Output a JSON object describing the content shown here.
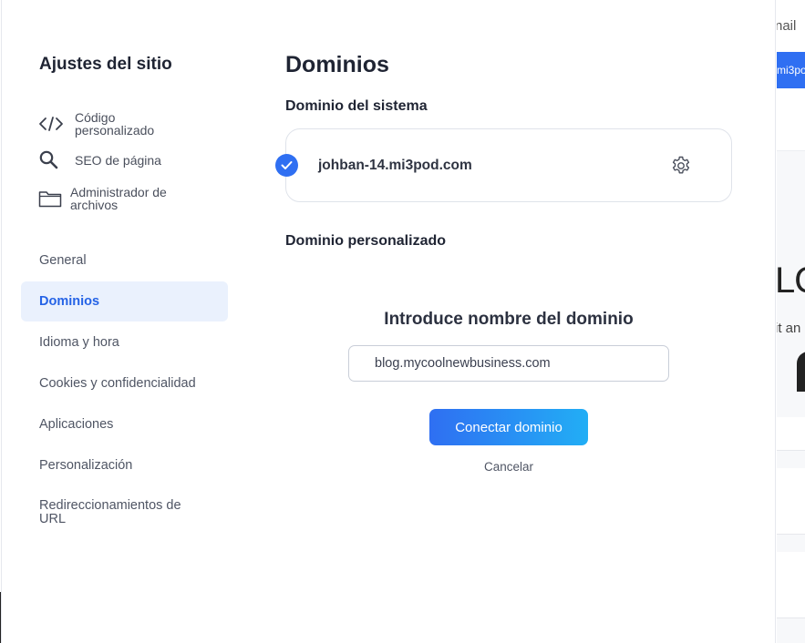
{
  "background": {
    "email_fragment": "nail",
    "button_fragment": "mi3po",
    "heading_fragment": "LO",
    "text_fragment": "it an"
  },
  "sidebar": {
    "title": "Ajustes del sitio",
    "tools": [
      {
        "label": "Código personalizado",
        "icon": "code-icon"
      },
      {
        "label": "SEO de página",
        "icon": "search-icon"
      },
      {
        "label": "Administrador de archivos",
        "icon": "folder-icon"
      }
    ],
    "nav": [
      {
        "label": "General"
      },
      {
        "label": "Dominios",
        "active": true
      },
      {
        "label": "Idioma y hora"
      },
      {
        "label": "Cookies y confidencialidad"
      },
      {
        "label": "Aplicaciones"
      },
      {
        "label": "Personalización"
      },
      {
        "label": "Redireccionamientos de URL"
      }
    ]
  },
  "main": {
    "title": "Dominios",
    "system_domain": {
      "heading": "Dominio del sistema",
      "domain": "johban-14.mi3pod.com",
      "checked": true
    },
    "custom_domain": {
      "heading": "Dominio personalizado",
      "form_title": "Introduce nombre del dominio",
      "input_placeholder": "blog.mycoolnewbusiness.com",
      "input_value": "",
      "connect_label": "Conectar dominio",
      "cancel_label": "Cancelar"
    }
  },
  "colors": {
    "accent": "#2f6ff2",
    "active_bg": "#eaf1fd",
    "active_text": "#2563e6"
  }
}
